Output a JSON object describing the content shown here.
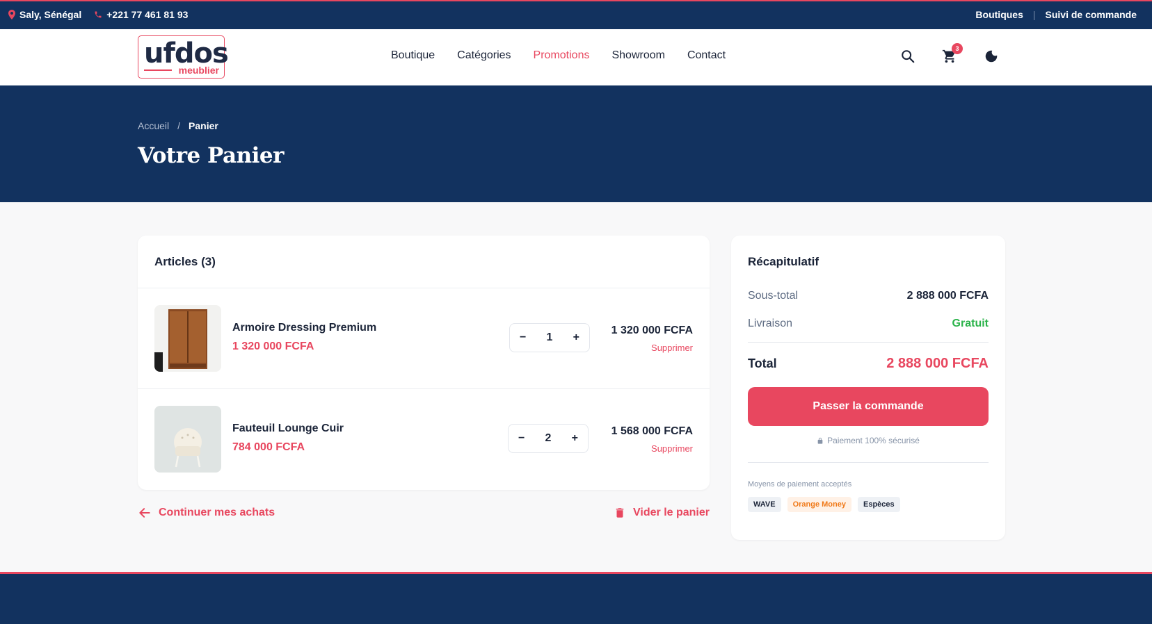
{
  "topbar": {
    "location": "Saly, Sénégal",
    "phone": "+221 77 461 81 93",
    "links": [
      "Boutiques",
      "Suivi de commande"
    ]
  },
  "header": {
    "logo_main": "ufdos",
    "logo_sub": "meublier",
    "nav": [
      "Boutique",
      "Catégories",
      "Promotions",
      "Showroom",
      "Contact"
    ],
    "active_nav": "Promotions",
    "cart_count": "3"
  },
  "hero": {
    "breadcrumb": [
      "Accueil",
      "Panier"
    ],
    "title": "Votre Panier"
  },
  "cart": {
    "heading": "Articles (3)",
    "items": [
      {
        "name": "Armoire Dressing Premium",
        "unit_price": "1 320 000 FCFA",
        "quantity": "1",
        "line_total": "1 320 000 FCFA",
        "remove_label": "Supprimer"
      },
      {
        "name": "Fauteuil Lounge Cuir",
        "unit_price": "784 000 FCFA",
        "quantity": "2",
        "line_total": "1 568 000 FCFA",
        "remove_label": "Supprimer"
      }
    ],
    "continue_label": "Continuer mes achats",
    "empty_label": "Vider le panier"
  },
  "summary": {
    "heading": "Récapitulatif",
    "subtotal_label": "Sous-total",
    "subtotal_value": "2 888 000 FCFA",
    "delivery_label": "Livraison",
    "delivery_value": "Gratuit",
    "total_label": "Total",
    "total_value": "2 888 000 FCFA",
    "checkout_label": "Passer la commande",
    "secure_label": "Paiement 100% sécurisé",
    "payment_methods_label": "Moyens de paiement acceptés",
    "payment_methods": [
      "WAVE",
      "Orange Money",
      "Espèces"
    ]
  },
  "colors": {
    "navy": "#12325f",
    "accent": "#e8475f",
    "success": "#2bb34a"
  }
}
